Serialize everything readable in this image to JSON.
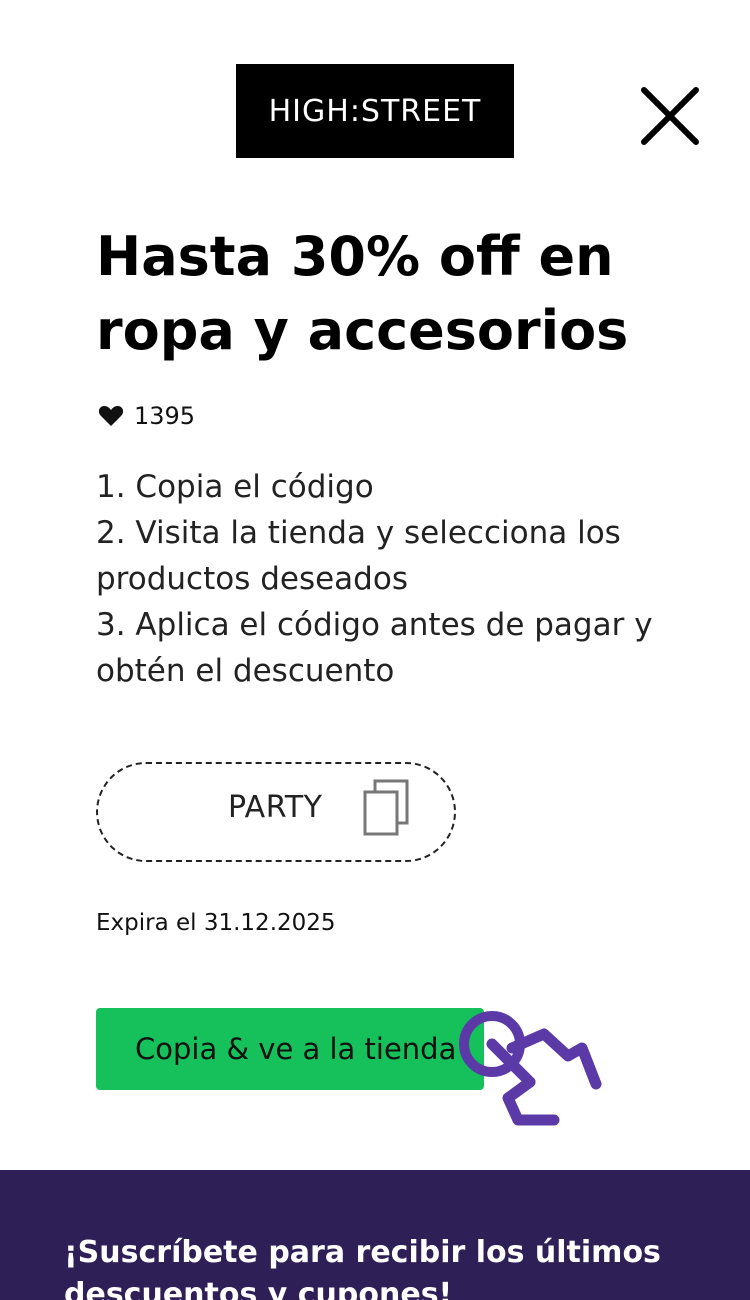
{
  "header": {
    "logo_text": "HIGH:STREET"
  },
  "offer": {
    "title": "Hasta 30% off en ropa y accesorios",
    "likes": "1395",
    "steps": [
      "1. Copia el código",
      "2. Visita la tienda y selecciona los productos deseados",
      "3. Aplica el código antes de pagar y obtén el descuento"
    ],
    "code": "PARTY",
    "expiry": "Expira el 31.12.2025",
    "cta_label": "Copia & ve a la tienda"
  },
  "footer": {
    "subscribe_text": "¡Suscríbete para recibir los últimos descuentos y cupones!"
  },
  "colors": {
    "cta_background": "#16c05a",
    "footer_background": "#2f1f57",
    "hand_icon": "#5b3aa8"
  },
  "icons": {
    "close": "close-icon",
    "like": "heart-icon",
    "copy": "copy-icon",
    "pointer": "hand-pointer-icon"
  }
}
